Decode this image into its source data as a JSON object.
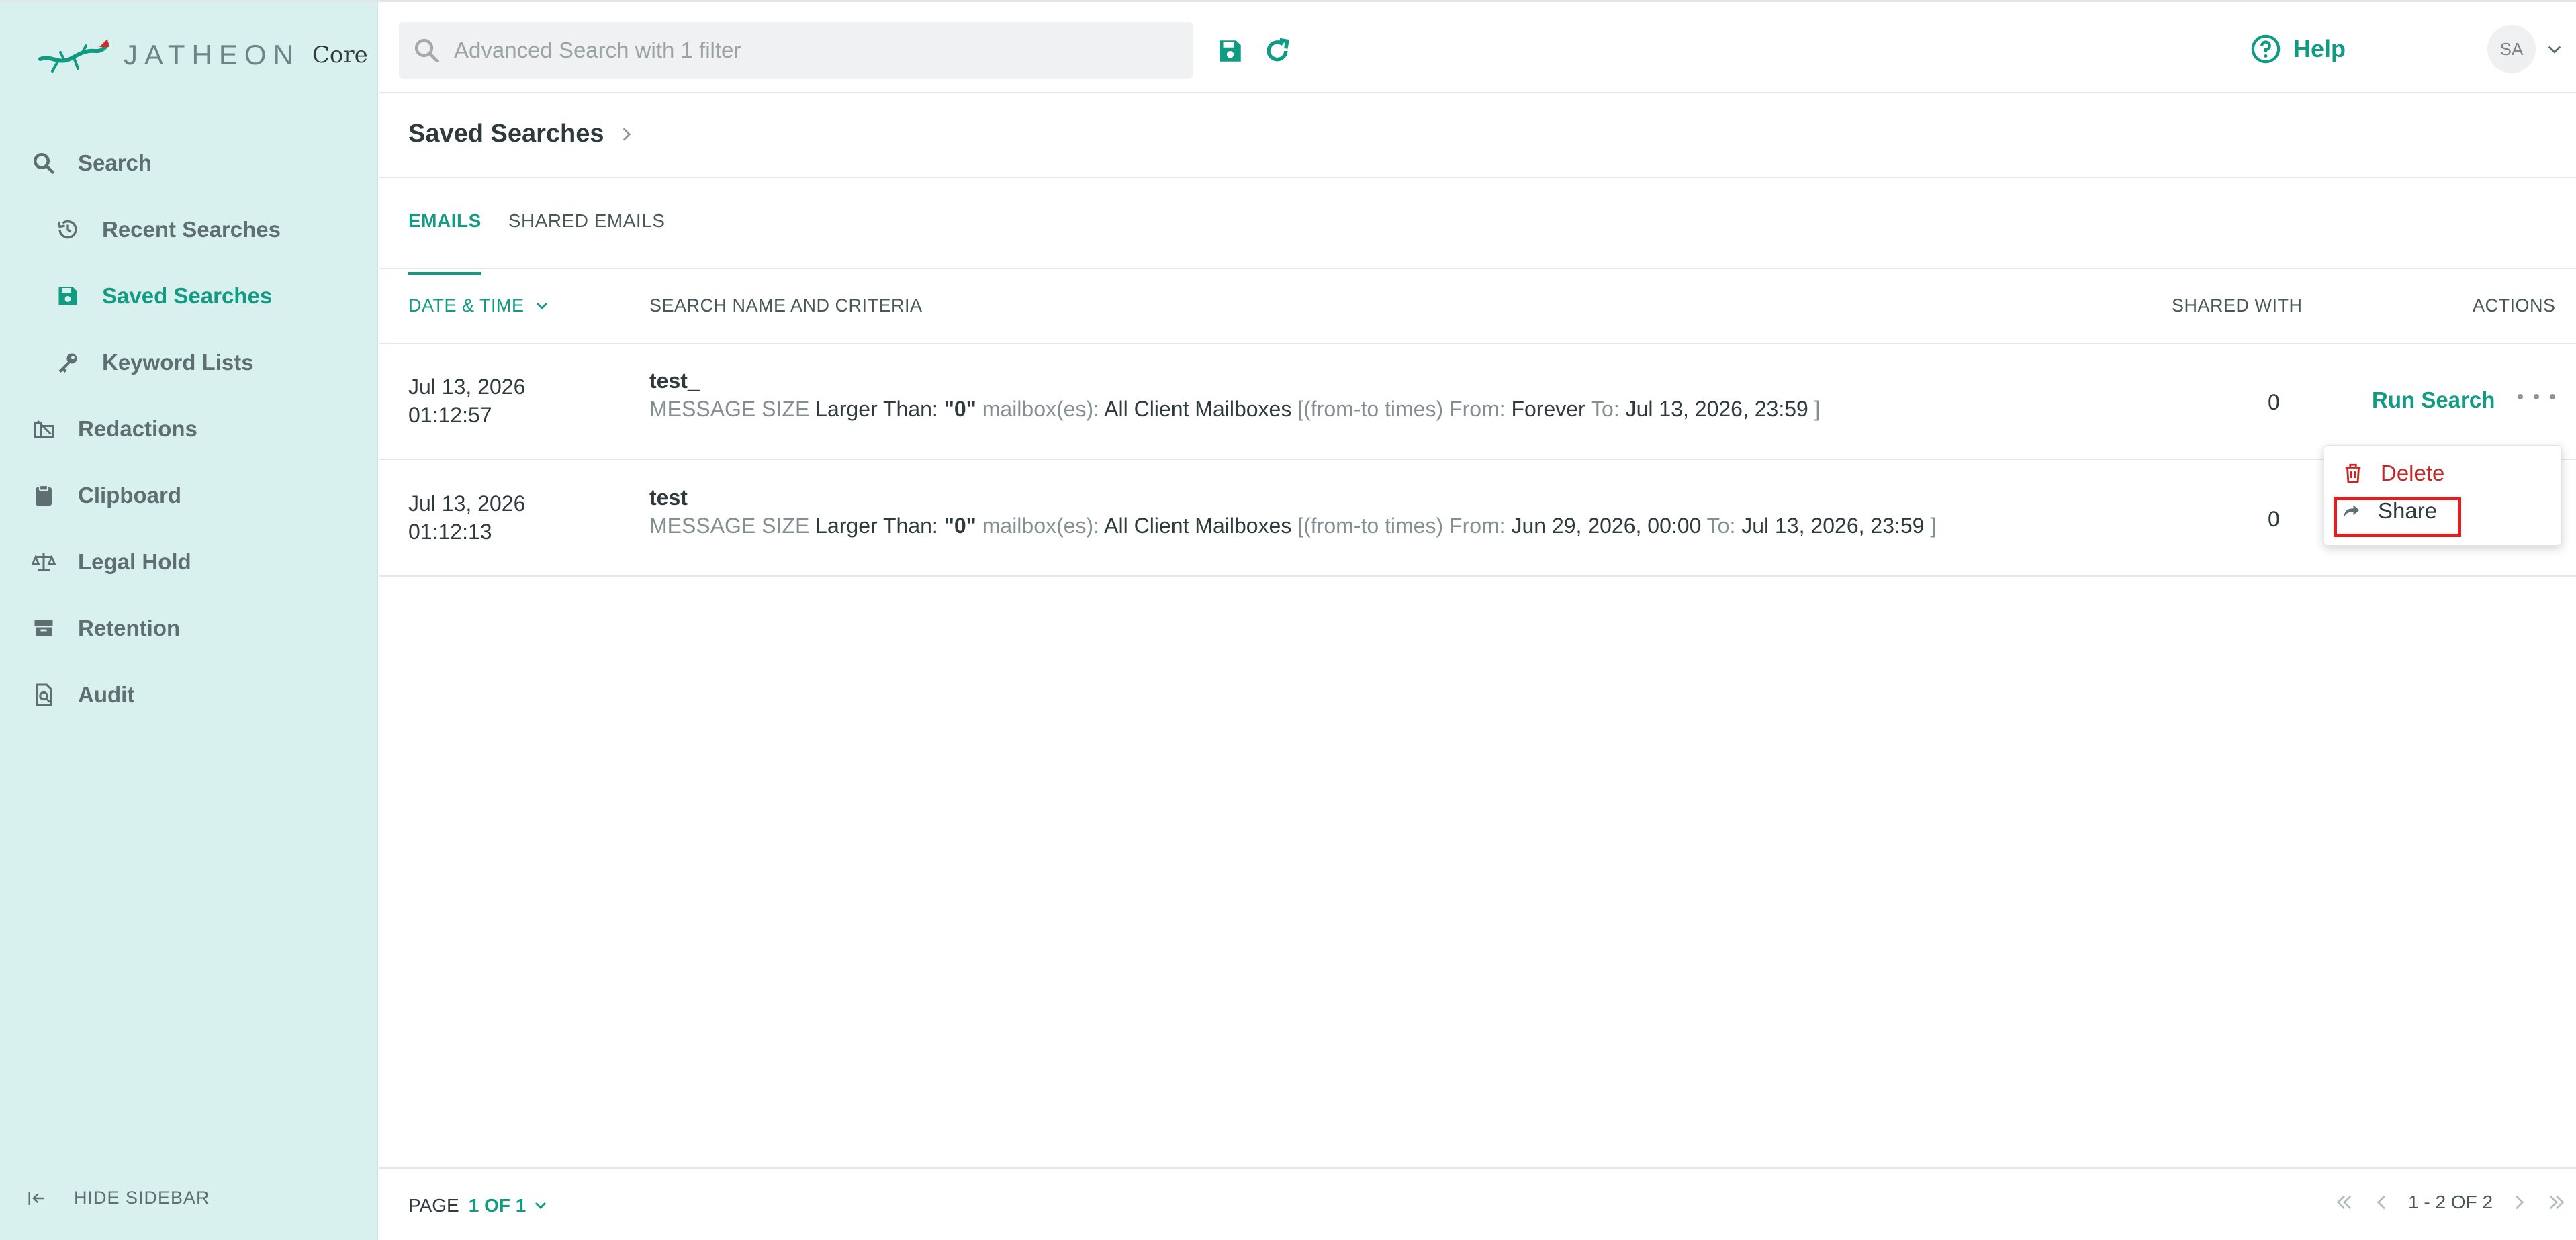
{
  "brand": {
    "name": "JATHEON",
    "product": "Core"
  },
  "sidebar": {
    "items": [
      {
        "label": "Search"
      },
      {
        "label": "Recent Searches"
      },
      {
        "label": "Saved Searches"
      },
      {
        "label": "Keyword Lists"
      },
      {
        "label": "Redactions"
      },
      {
        "label": "Clipboard"
      },
      {
        "label": "Legal Hold"
      },
      {
        "label": "Retention"
      },
      {
        "label": "Audit"
      }
    ],
    "hide_label": "HIDE SIDEBAR"
  },
  "topbar": {
    "search_placeholder": "Advanced Search with 1 filter",
    "help_label": "Help",
    "avatar_initials": "SA"
  },
  "breadcrumb": {
    "title": "Saved Searches"
  },
  "tabs": [
    {
      "label": "EMAILS"
    },
    {
      "label": "SHARED EMAILS"
    }
  ],
  "table": {
    "headers": {
      "date": "DATE & TIME",
      "name": "SEARCH NAME AND CRITERIA",
      "shared": "SHARED WITH",
      "actions": "ACTIONS"
    },
    "rows": [
      {
        "date": "Jul 13, 2026",
        "time": "01:12:57",
        "name": "test_",
        "c_size_lbl": "MESSAGE SIZE",
        "c_size_val": "Larger Than:",
        "c_size_num": "\"0\"",
        "c_mb_lbl": "mailbox(es):",
        "c_mb_val": "All Client Mailboxes",
        "c_ft_lbl": "[(from-to times) From:",
        "c_from": "Forever",
        "c_to_lbl": "To:",
        "c_to": "Jul 13, 2026, 23:59",
        "c_end": "]",
        "shared": "0",
        "run_label": "Run Search"
      },
      {
        "date": "Jul 13, 2026",
        "time": "01:12:13",
        "name": "test",
        "c_size_lbl": "MESSAGE SIZE",
        "c_size_val": "Larger Than:",
        "c_size_num": "\"0\"",
        "c_mb_lbl": "mailbox(es):",
        "c_mb_val": "All Client Mailboxes",
        "c_ft_lbl": "[(from-to times) From:",
        "c_from": "Jun 29, 2026, 00:00",
        "c_to_lbl": "To:",
        "c_to": "Jul 13, 2026, 23:59",
        "c_end": "]",
        "shared": "0"
      }
    ]
  },
  "menu": {
    "delete_label": "Delete",
    "share_label": "Share"
  },
  "footer": {
    "page_label": "PAGE",
    "page_value": "1 OF 1",
    "range": "1 - 2 OF 2"
  },
  "colors": {
    "accent": "#119b83",
    "sidebar_bg": "#d8f1ee",
    "danger": "#c62828",
    "highlight": "#e02020"
  }
}
